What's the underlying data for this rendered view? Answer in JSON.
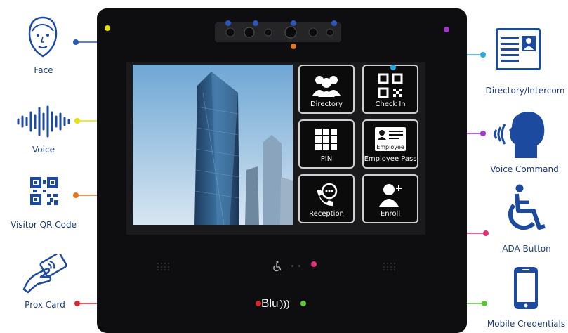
{
  "features_left": [
    "Face",
    "Voice",
    "Visitor QR Code",
    "Prox Card"
  ],
  "features_right": [
    "Directory/Intercom",
    "Voice Command",
    "ADA Button",
    "Mobile Credentials"
  ],
  "tiles": [
    "Directory",
    "Check In",
    "PIN",
    "Employee Pass",
    "Reception",
    "Enroll"
  ],
  "badge_text": "Employee",
  "brand": "Blu",
  "colors": {
    "face": "#2b58b8",
    "voice": "#e4e20a",
    "qr": "#e0771f",
    "prox": "#d9262c",
    "directory": "#28a8e0",
    "voice_command": "#a335c8",
    "ada": "#e0307a",
    "mobile": "#5cc43a",
    "icon_blue": "#1b4a9e"
  }
}
